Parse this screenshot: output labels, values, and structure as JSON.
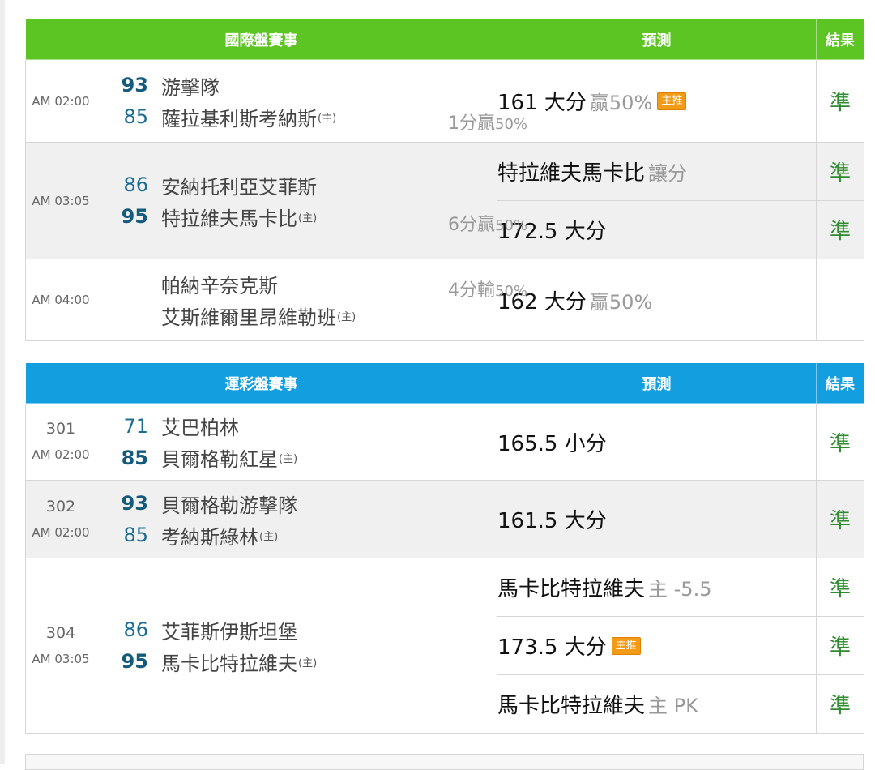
{
  "colors": {
    "intl_header": "#5cc423",
    "sport_header": "#139ee0",
    "score": "#1b6c93",
    "result_correct": "#2e8b2e",
    "badge": "#f29b16"
  },
  "intl": {
    "header": {
      "match": "國際盤賽事",
      "prediction": "預測",
      "result": "結果"
    },
    "rows": [
      {
        "time": "AM 02:00",
        "away": {
          "score": "93",
          "name": "游擊隊"
        },
        "home": {
          "score": "85",
          "name": "薩拉基利斯考納斯",
          "mark": "(主)"
        },
        "handicap": {
          "text": "1分贏",
          "pct": "50%"
        },
        "pred1": {
          "main": "161 大分",
          "sub": "贏50%",
          "badge": "主推",
          "result": "準"
        }
      },
      {
        "time": "AM 03:05",
        "away": {
          "score": "86",
          "name": "安納托利亞艾菲斯"
        },
        "home": {
          "score": "95",
          "name": "特拉維夫馬卡比",
          "mark": "(主)"
        },
        "handicap": {
          "text": "6分贏",
          "pct": "50%"
        },
        "pred1": {
          "main": "特拉維夫馬卡比",
          "sub": "讓分",
          "result": "準"
        },
        "pred2": {
          "main": "172.5 大分",
          "result": "準"
        }
      },
      {
        "time": "AM 04:00",
        "away": {
          "name": "帕納辛奈克斯"
        },
        "home": {
          "name": "艾斯維爾里昂維勒班",
          "mark": "(主)"
        },
        "handicap": {
          "text": "4分輸",
          "pct": "50%"
        },
        "pred1": {
          "main": "162 大分",
          "sub": "贏50%",
          "result": ""
        }
      }
    ]
  },
  "sport": {
    "header": {
      "match": "運彩盤賽事",
      "prediction": "預測",
      "result": "結果"
    },
    "rows": [
      {
        "num": "301",
        "time": "AM 02:00",
        "away": {
          "score": "71",
          "name": "艾巴柏林"
        },
        "home": {
          "score": "85",
          "name": "貝爾格勒紅星",
          "mark": "(主)"
        },
        "pred1": {
          "main": "165.5 小分",
          "result": "準"
        }
      },
      {
        "num": "302",
        "time": "AM 02:00",
        "away": {
          "score": "93",
          "name": "貝爾格勒游擊隊"
        },
        "home": {
          "score": "85",
          "name": "考納斯綠林",
          "mark": "(主)"
        },
        "pred1": {
          "main": "161.5 大分",
          "result": "準"
        }
      },
      {
        "num": "304",
        "time": "AM 03:05",
        "away": {
          "score": "86",
          "name": "艾菲斯伊斯坦堡"
        },
        "home": {
          "score": "95",
          "name": "馬卡比特拉維夫",
          "mark": "(主)"
        },
        "pred1": {
          "main": "馬卡比特拉維夫",
          "sub": "主 -5.5",
          "result": "準"
        },
        "pred2": {
          "main": "173.5 大分",
          "badge": "主推",
          "result": "準"
        },
        "pred3": {
          "main": "馬卡比特拉維夫",
          "sub": "主 PK",
          "result": "準"
        }
      }
    ]
  }
}
